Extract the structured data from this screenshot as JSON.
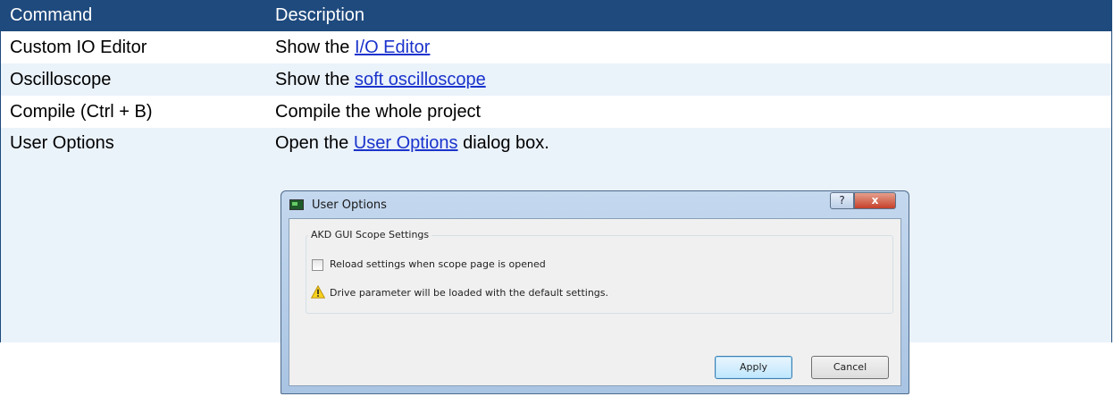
{
  "table": {
    "headers": [
      "Command",
      "Description"
    ],
    "rows": [
      {
        "command": "Custom IO Editor",
        "desc_prefix": "Show the ",
        "desc_link": "I/O Editor",
        "desc_suffix": ""
      },
      {
        "command": "Oscilloscope",
        "desc_prefix": "Show the ",
        "desc_link": "soft oscilloscope",
        "desc_suffix": ""
      },
      {
        "command": "Compile (Ctrl + B)",
        "desc_prefix": "Compile the whole project",
        "desc_link": "",
        "desc_suffix": ""
      },
      {
        "command": "User Options",
        "desc_prefix": "Open the ",
        "desc_link": "User Options",
        "desc_suffix": " dialog box."
      }
    ]
  },
  "dialog": {
    "title": "User Options",
    "help_button": "?",
    "close_button": "x",
    "group_title": "AKD GUI Scope Settings",
    "checkbox_label": "Reload settings when scope page is opened",
    "checkbox_checked": false,
    "warning_text": "Drive parameter will be loaded with the default settings.",
    "apply_label": "Apply",
    "cancel_label": "Cancel",
    "warning_icon": "warning-triangle-icon",
    "app_icon": "application-icon"
  },
  "colors": {
    "header_bg": "#1f4a7d",
    "row_alt_bg": "#eaf2fa",
    "link": "#1a33cc"
  }
}
